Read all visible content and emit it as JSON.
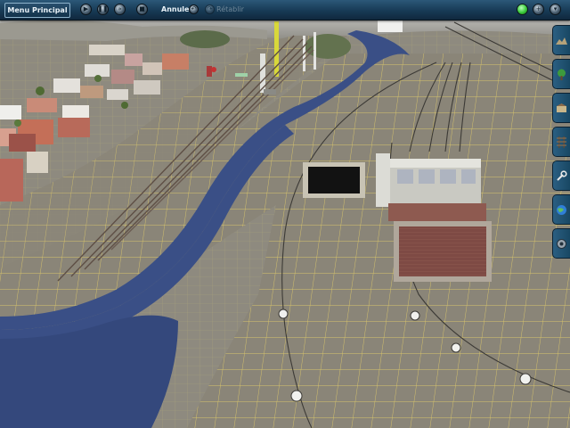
{
  "toolbar": {
    "menu_label": "Menu Principal",
    "undo_label": "Annuler",
    "redo_label": "Rétablir",
    "left_icons": [
      "play-icon",
      "pause-icon",
      "speed-icon",
      "stop-icon"
    ],
    "right_icons": [
      "status-light-icon",
      "zoom-in-icon",
      "zoom-out-icon"
    ]
  },
  "side_panel": {
    "tools": [
      "terrain-tool-icon",
      "tree-tool-icon",
      "object-tool-icon",
      "track-tool-icon",
      "wrench-tool-icon",
      "globe-tool-icon",
      "camera-tool-icon"
    ]
  },
  "colors": {
    "toolbar": "#173a55",
    "terrain": "#8f8a7d",
    "grid": "#e6d26e",
    "river": "#3a4f86",
    "status_light": "#39c93a"
  }
}
